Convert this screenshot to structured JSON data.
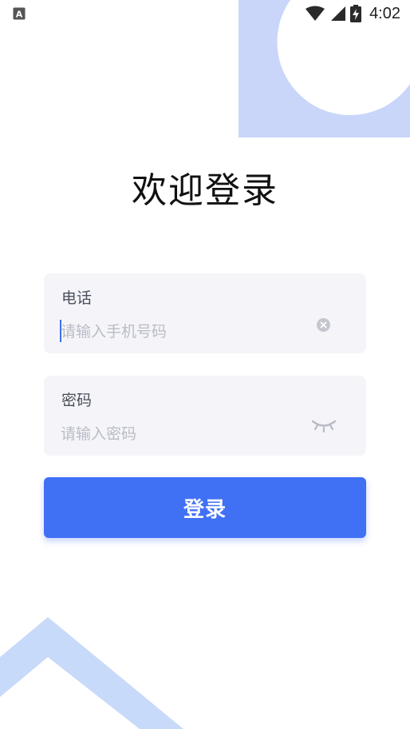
{
  "status_bar": {
    "time": "4:02",
    "notification_icon": "a-square-icon",
    "icons": [
      "wifi-icon",
      "cellular-signal-icon",
      "battery-charging-icon"
    ]
  },
  "page": {
    "title": "欢迎登录"
  },
  "phone_field": {
    "label": "电话",
    "placeholder": "请输入手机号码",
    "value": "",
    "clear_icon": "clear-circle-icon"
  },
  "password_field": {
    "label": "密码",
    "placeholder": "请输入密码",
    "value": "",
    "visibility_icon": "eye-closed-icon"
  },
  "login_button": {
    "label": "登录"
  },
  "colors": {
    "primary": "#4070f4",
    "field_background": "#f5f5f9",
    "decoration_ring": "#c9d6fa",
    "decoration_chevron": "#c8dafa",
    "placeholder": "#b9bcc6",
    "label": "#4a4f5c"
  }
}
